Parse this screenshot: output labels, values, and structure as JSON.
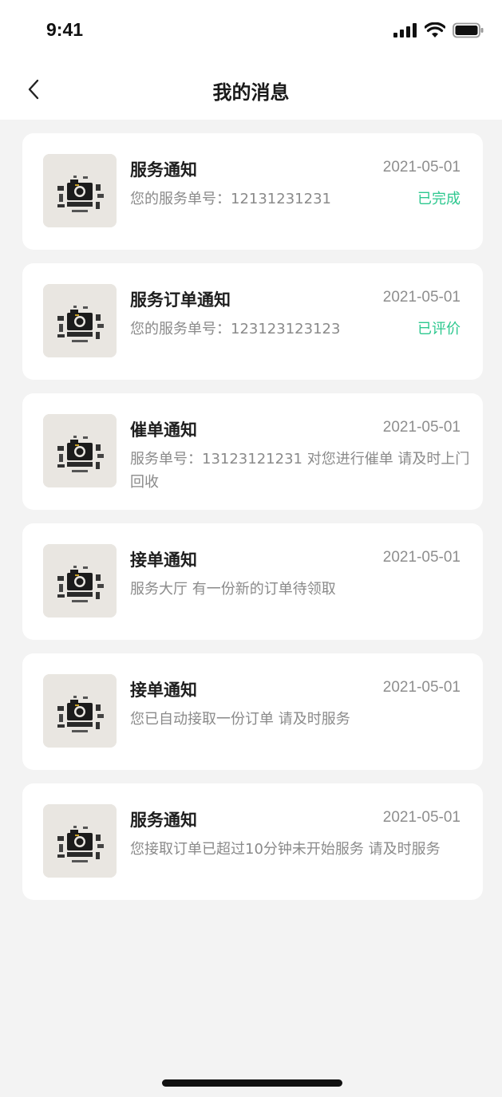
{
  "status_bar": {
    "time": "9:41"
  },
  "nav": {
    "title": "我的消息"
  },
  "messages": [
    {
      "title": "服务通知",
      "date": "2021-05-01",
      "body": "您的服务单号：12131231231",
      "status": "已完成"
    },
    {
      "title": "服务订单通知",
      "date": "2021-05-01",
      "body": "您的服务单号：123123123123",
      "status": "已评价"
    },
    {
      "title": "催单通知",
      "date": "2021-05-01",
      "body": "服务单号：13123121231 对您进行催单 请及时上门回收",
      "status": ""
    },
    {
      "title": "接单通知",
      "date": "2021-05-01",
      "body": "服务大厅 有一份新的订单待领取",
      "status": ""
    },
    {
      "title": "接单通知",
      "date": "2021-05-01",
      "body": "您已自动接取一份订单 请及时服务",
      "status": ""
    },
    {
      "title": "服务通知",
      "date": "2021-05-01",
      "body": "您接取订单已超过10分钟未开始服务 请及时服务",
      "status": ""
    }
  ],
  "colors": {
    "accent_green": "#2dc88f",
    "background": "#f3f3f3"
  },
  "icons": {
    "back": "chevron-left-icon",
    "signal": "signal-icon",
    "wifi": "wifi-icon",
    "battery": "battery-icon"
  }
}
